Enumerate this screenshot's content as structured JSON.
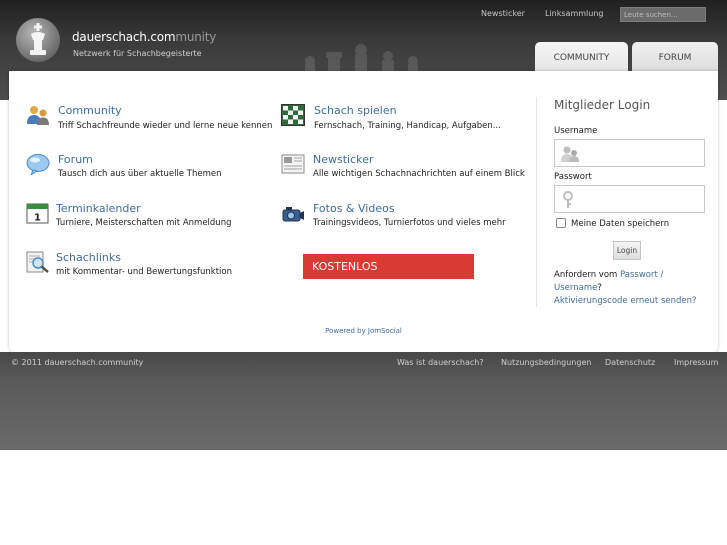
{
  "header": {
    "site_name_bold": "dauerschach.com",
    "site_name_light": "munity",
    "tagline": "Netzwerk für Schachbegeisterte",
    "top_links": [
      "Newsticker",
      "Linksammlung"
    ],
    "search_placeholder": "Leute suchen..."
  },
  "tabs": [
    {
      "label": "COMMUNITY",
      "active": true
    },
    {
      "label": "FORUM",
      "active": false
    }
  ],
  "features": [
    {
      "title": "Community",
      "desc": "Triff Schachfreunde wieder und lerne neue kennen",
      "icon": "users-icon"
    },
    {
      "title": "Schach spielen",
      "desc": "Fernschach, Training, Handicap, Aufgaben...",
      "icon": "chessboard-icon"
    },
    {
      "title": "Forum",
      "desc": "Tausch dich aus über aktuelle Themen",
      "icon": "speech-bubble-icon"
    },
    {
      "title": "Newsticker",
      "desc": "Alle wichtigen Schachnachrichten auf einem Blick",
      "icon": "newspaper-icon"
    },
    {
      "title": "Terminkalender",
      "desc": "Turniere, Meisterschaften mit Anmeldung",
      "icon": "calendar-icon"
    },
    {
      "title": "Fotos & Videos",
      "desc": "Trainingsvideos, Turnierfotos und vieles mehr",
      "icon": "camera-icon"
    },
    {
      "title": "Schachlinks",
      "desc": "mit Kommentar- und Bewertungsfunktion",
      "icon": "magnifier-icon"
    }
  ],
  "cta_label": "KOSTENLOS",
  "login": {
    "title": "Mitglieder Login",
    "username_label": "Username",
    "password_label": "Passwort",
    "remember_label": "Meine Daten speichern",
    "button_label": "Login",
    "forgot_prefix": "Anfordern vom",
    "forgot_link1": "Passwort /",
    "forgot_link2": "Username",
    "forgot_suffix": "?",
    "activation_link": "Aktivierungscode erneut senden?"
  },
  "powered_by": "Powered by JomSocial",
  "footer": {
    "copyright": "© 2011 dauerschach.community",
    "links": [
      "Was ist dauerschach?",
      "Nutzungsbedingungen",
      "Datenschutz",
      "Impressum"
    ]
  }
}
